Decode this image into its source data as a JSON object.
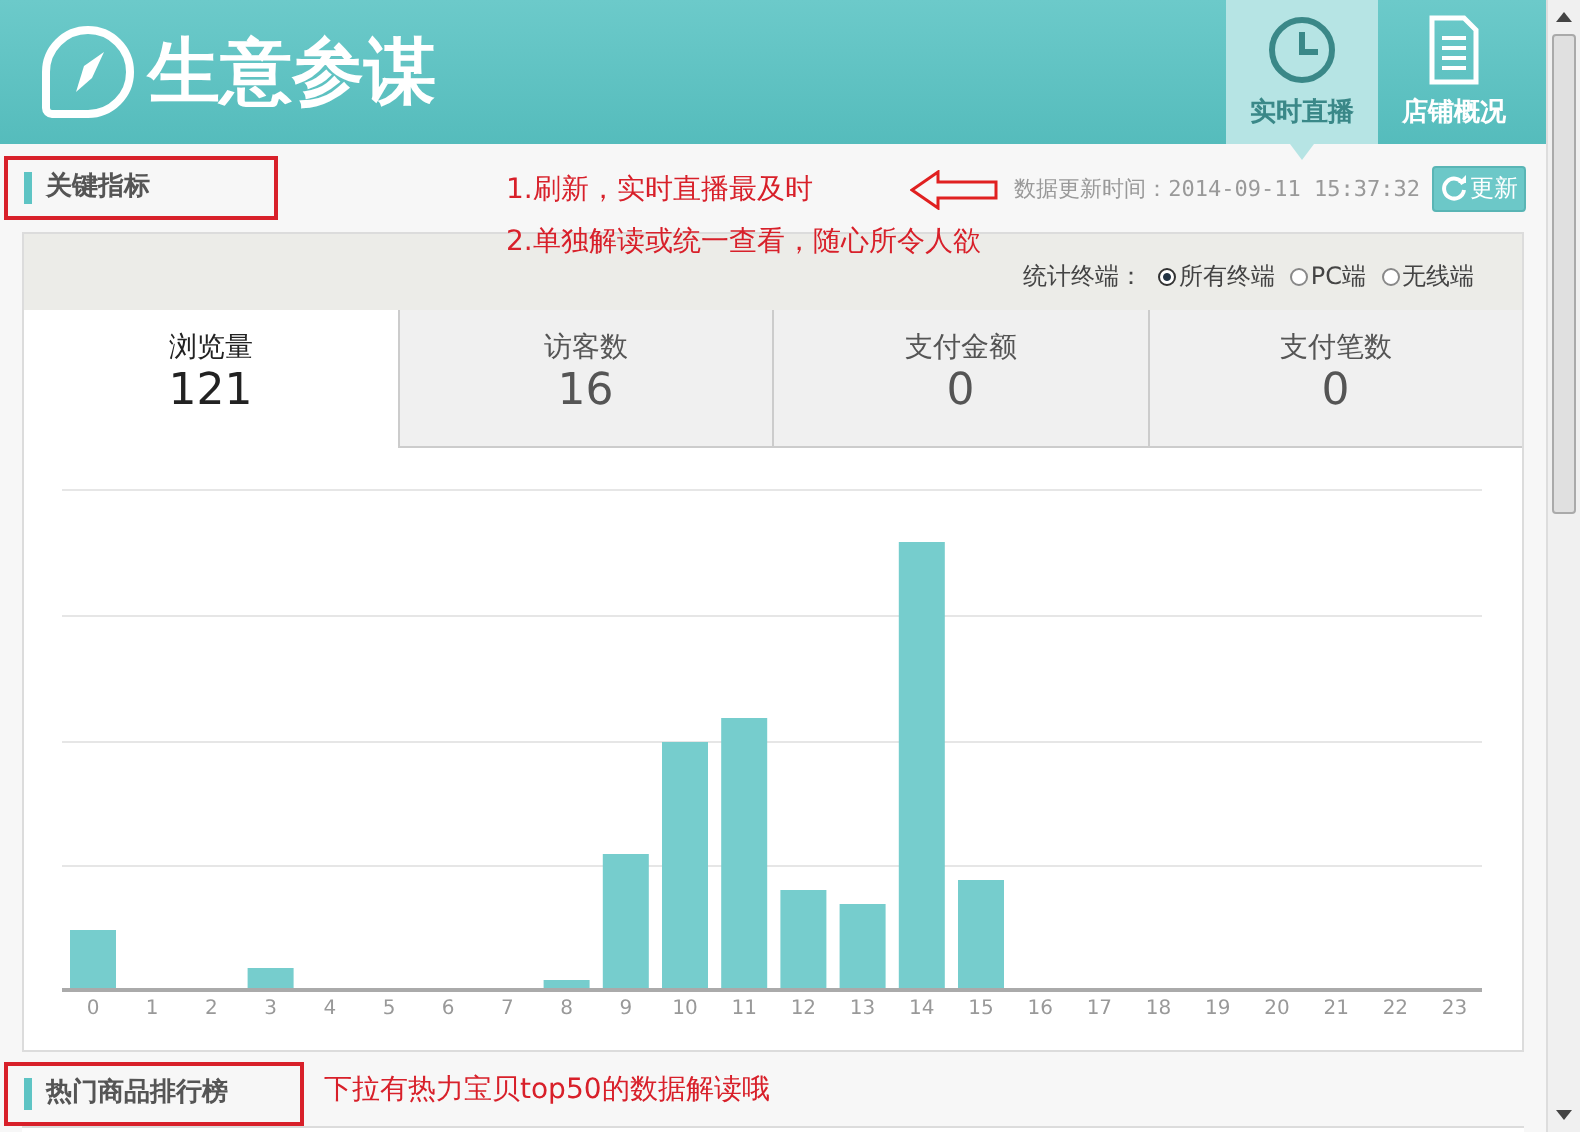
{
  "header": {
    "title": "生意参谋",
    "nav": [
      {
        "label": "实时直播",
        "kind": "clock",
        "selected": true
      },
      {
        "label": "店铺概况",
        "kind": "document",
        "selected": false
      }
    ]
  },
  "key_metrics": {
    "title": "关键指标",
    "annotations": [
      "1.刷新，实时直播最及时",
      "2.单独解读或统一查看，随心所令人欲"
    ],
    "update_time": "数据更新时间：2014-09-11 15:37:32",
    "refresh_button": "更新",
    "terminal_label": "统计终端：",
    "terminals": [
      {
        "label": "所有终端",
        "selected": true
      },
      {
        "label": "PC端",
        "selected": false
      },
      {
        "label": "无线端",
        "selected": false
      }
    ],
    "tabs": [
      {
        "label": "浏览量",
        "value": "121",
        "selected": true
      },
      {
        "label": "访客数",
        "value": "16",
        "selected": false
      },
      {
        "label": "支付金额",
        "value": "0",
        "selected": false
      },
      {
        "label": "支付笔数",
        "value": "0",
        "selected": false
      }
    ],
    "chart": {
      "x_labels": [
        "0",
        "1",
        "2",
        "3",
        "4",
        "5",
        "6",
        "7",
        "8",
        "9",
        "10",
        "11",
        "12",
        "13",
        "14",
        "15",
        "16",
        "17",
        "18",
        "19",
        "20",
        "21",
        "22",
        "23"
      ]
    }
  },
  "hot_products": {
    "title": "热门商品排行榜",
    "annotation": "下拉有热力宝贝top50的数据解读哦"
  }
}
